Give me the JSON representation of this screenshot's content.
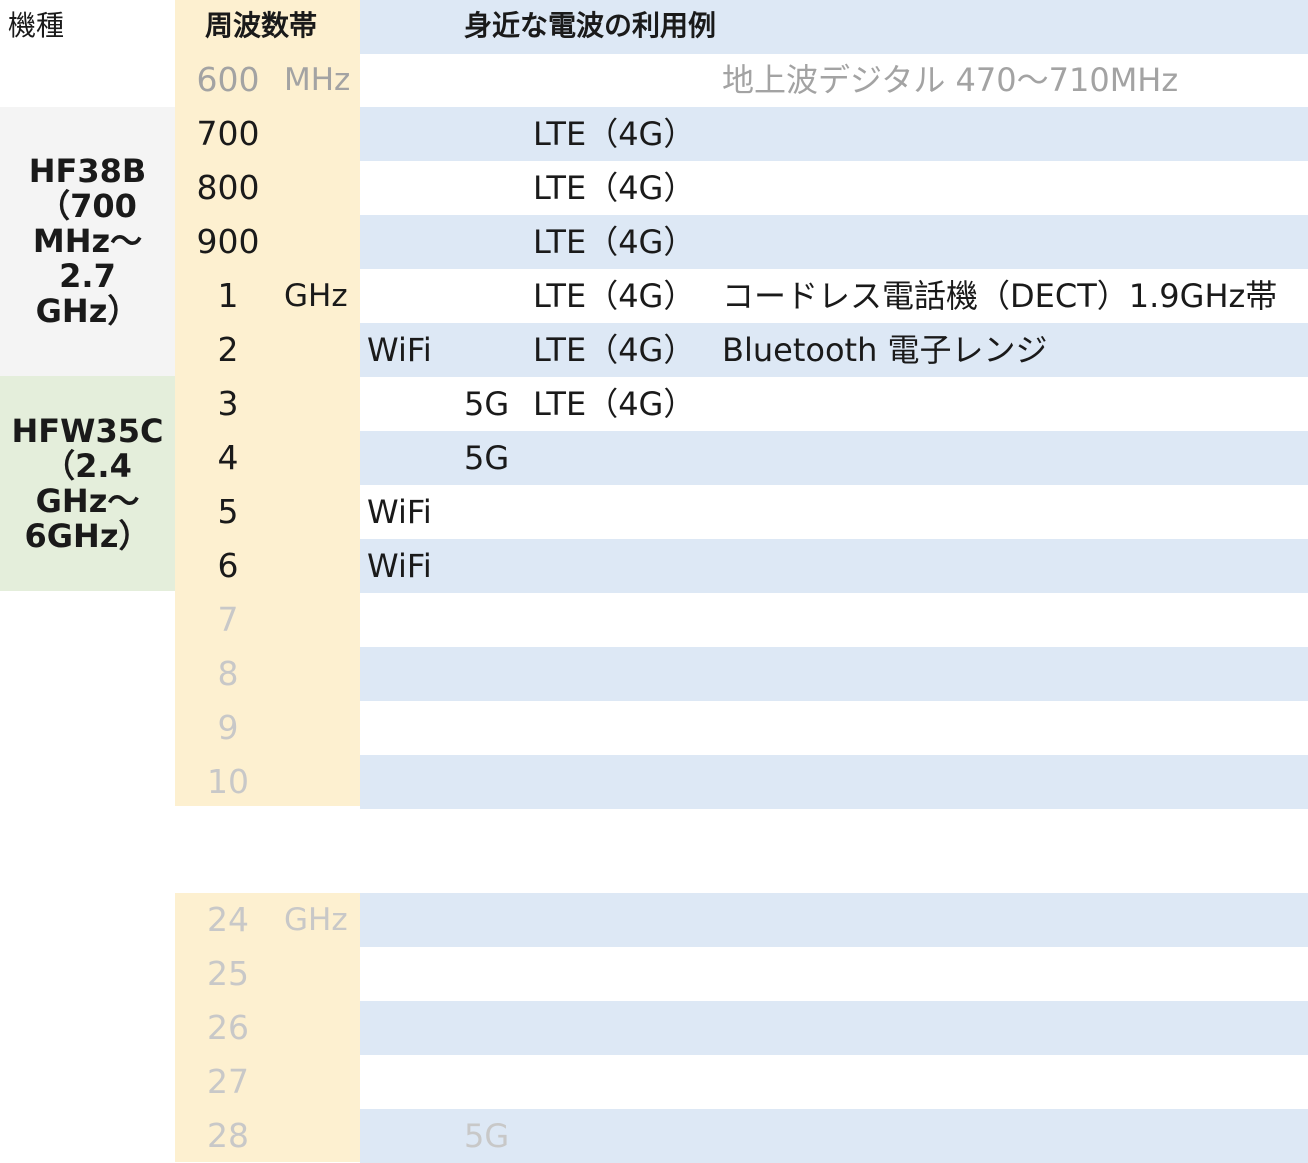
{
  "header": {
    "model": "機種",
    "band": "周波数帯",
    "uses": "身近な電波の利用例"
  },
  "models": [
    {
      "label": "HF38B\n（700\nMHz～\n2.7\nGHz）",
      "color": "#f4f4f4"
    },
    {
      "label": "HFW35C\n（2.4\nGHz～\n6GHz）",
      "color": "#e4eedb"
    }
  ],
  "rows": [
    {
      "freq": "600",
      "unit": "MHz",
      "faded": true,
      "wifi": "",
      "g5": "",
      "lte": "",
      "other": "地上波デジタル 470～710MHz",
      "other_faded": true
    },
    {
      "freq": "700",
      "unit": "",
      "faded": false,
      "wifi": "",
      "g5": "",
      "lte": "LTE（4G）",
      "other": ""
    },
    {
      "freq": "800",
      "unit": "",
      "faded": false,
      "wifi": "",
      "g5": "",
      "lte": "LTE（4G）",
      "other": ""
    },
    {
      "freq": "900",
      "unit": "",
      "faded": false,
      "wifi": "",
      "g5": "",
      "lte": "LTE（4G）",
      "other": ""
    },
    {
      "freq": "1",
      "unit": "GHz",
      "faded": false,
      "wifi": "",
      "g5": "",
      "lte": "LTE（4G）",
      "other": "コードレス電話機（DECT）1.9GHz帯"
    },
    {
      "freq": "2",
      "unit": "",
      "faded": false,
      "wifi": "WiFi",
      "g5": "",
      "lte": "LTE（4G）",
      "other": "Bluetooth  電子レンジ"
    },
    {
      "freq": "3",
      "unit": "",
      "faded": false,
      "wifi": "",
      "g5": "5G",
      "lte": "LTE（4G）",
      "other": ""
    },
    {
      "freq": "4",
      "unit": "",
      "faded": false,
      "wifi": "",
      "g5": "5G",
      "lte": "",
      "other": ""
    },
    {
      "freq": "5",
      "unit": "",
      "faded": false,
      "wifi": "WiFi",
      "g5": "",
      "lte": "",
      "other": ""
    },
    {
      "freq": "6",
      "unit": "",
      "faded": false,
      "wifi": "WiFi",
      "g5": "",
      "lte": "",
      "other": ""
    },
    {
      "freq": "7",
      "unit": "",
      "faded": true,
      "wifi": "",
      "g5": "",
      "lte": "",
      "other": ""
    },
    {
      "freq": "8",
      "unit": "",
      "faded": true,
      "wifi": "",
      "g5": "",
      "lte": "",
      "other": ""
    },
    {
      "freq": "9",
      "unit": "",
      "faded": true,
      "wifi": "",
      "g5": "",
      "lte": "",
      "other": ""
    },
    {
      "freq": "10",
      "unit": "",
      "faded": true,
      "wifi": "",
      "g5": "",
      "lte": "",
      "other": ""
    }
  ],
  "rows_high": [
    {
      "freq": "24",
      "unit": "GHz",
      "g5": ""
    },
    {
      "freq": "25",
      "unit": "",
      "g5": ""
    },
    {
      "freq": "26",
      "unit": "",
      "g5": ""
    },
    {
      "freq": "27",
      "unit": "",
      "g5": ""
    },
    {
      "freq": "28",
      "unit": "",
      "g5": "5G"
    }
  ],
  "colors": {
    "band_column": "#fdf0d0",
    "row_stripe": "#dde8f5",
    "model_a": "#f4f4f4",
    "model_b": "#e4eedb"
  }
}
